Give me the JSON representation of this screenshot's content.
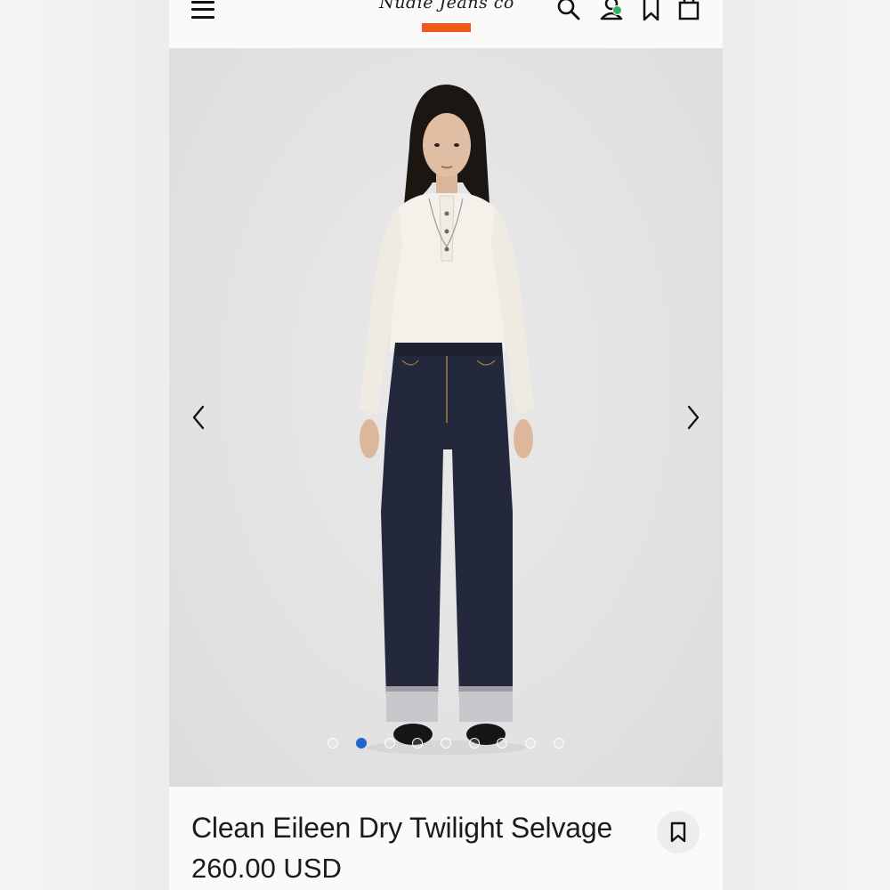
{
  "header": {
    "logo_text": "Nudie Jeans co",
    "brand_color": "#ee5a1e",
    "icons": [
      "menu-icon",
      "search-icon",
      "user-icon",
      "bookmark-icon",
      "shopping-bag-icon"
    ],
    "account_status_color": "#32b561"
  },
  "gallery": {
    "prev_icon": "chevron-left-icon",
    "next_icon": "chevron-right-icon",
    "total_images": 9,
    "active_index": 1,
    "active_dot_color": "#2266cc"
  },
  "product": {
    "name": "Clean Eileen Dry Twilight Selvage",
    "price": "260.00 USD",
    "save_icon": "bookmark-icon"
  }
}
